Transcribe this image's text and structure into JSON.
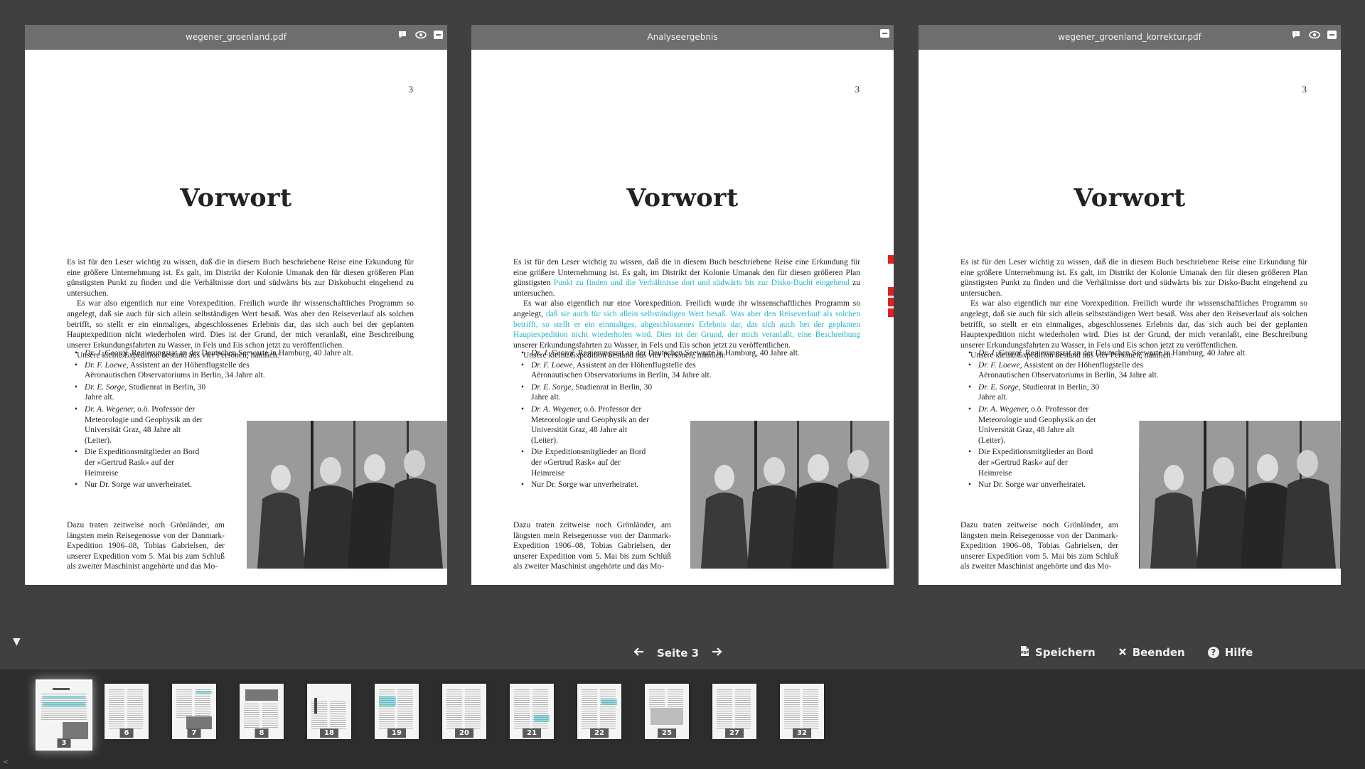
{
  "panels": [
    {
      "title": "wegener_groenland.pdf",
      "has_icons": true
    },
    {
      "title": "Analyseergebnis",
      "has_icons": false
    },
    {
      "title": "wegener_groenland_korrektur.pdf",
      "has_icons": true
    }
  ],
  "icons": {
    "comment": "comment-icon",
    "view": "eye-icon",
    "minimize": "minimize-icon"
  },
  "document": {
    "page_number": "3",
    "heading": "Vorwort",
    "p1": "Es ist für den Leser wichtig zu wissen, daß die in diesem Buch beschriebene Reise eine Erkundung für eine größere Unternehmung ist. Es galt, im Distrikt der Kolonie Umanak den für diesen größeren Plan günstigsten Punkt zu finden und die Verhältnisse dort und südwärts bis zur Diskobucht eingehend zu untersuchen.",
    "p2": "Es war also eigentlich nur eine Vorexpedition. Freilich wurde ihr wissenschaftliches Programm so angelegt, daß sie auch für sich allein selbständigen Wert besaß. Was aber den Reiseverlauf als solchen betrifft, so stellt er ein einmaliges, abgeschlossenes Erlebnis dar, das sich auch bei der geplanten Hauptexpedition nicht wiederholen wird. Dies ist der Grund, der mich veranlaßt, eine Beschreibung unserer Erkundungsfahrten zu Wasser, in Fels und Eis schon jetzt zu veröffentlichen.",
    "p3": "Unsere kleine Expedition bestand aus vier Personen, nämlich:",
    "bullets": [
      {
        "name": "Dr. J. Georgi,",
        "text": " Regierungsrat an der Deutschen Seewarte in Hamburg, 40 Jahre alt."
      },
      {
        "name": "Dr. F. Loewe,",
        "text": " Assistent an der Höhenflugstelle des Aëronautischen Observatoriums in Berlin, 34 Jahre alt."
      },
      {
        "name": "Dr. E. Sorge,",
        "text": " Studienrat in Berlin, 30 Jahre alt."
      },
      {
        "name": "Dr. A. Wegener,",
        "text": " o.ö. Professor der Meteorologie und Geophysik an der Universität Graz, 48 Jahre alt (Leiter)."
      },
      {
        "name": "",
        "text": "Die Expeditionsmitglieder an Bord der »Gertrud Rask« auf der Heimreise"
      },
      {
        "name": "",
        "text": "Nur Dr. Sorge war unverheiratet."
      }
    ],
    "p4": "Dazu traten zeitweise noch Grönländer, am längsten mein Reisegenosse von der Danmark-Expedition 1906–08, Tobias Gabrielsen, der unserer Expedition vom 5. Mai bis zum Schluß als zweiter Maschinist angehörte und das Mo-",
    "p1_korrektur": "Es ist für den Leser wichtig zu wissen, daß die in diesem Buch beschriebene Reise eine Erkundung für eine größere Unternehmung ist. Es galt, im Distrikt der Kolonie Umanak den für diesen größeren Plan günstigsten Punkt zu finden und die Verhältnisse dort und südwärts bis zur Disko-Bucht eingehend zu untersuchen.",
    "p2_korrektur": "Es war also eigentlich nur eine Vorexpedition. Freilich wurde ihr wissenschaftliches Programm so angelegt, daß sie auch für sich allein selbstständigen Wert besaß. Was aber den Reiseverlauf als solchen betrifft, so stellt er ein einmaliges, abgeschlossenes Erlebnis dar, das sich auch bei der geplanten Hauptexpedition nicht wiederholen wird. Dies ist der Grund, der mich veranlaßt, eine Beschreibung unserer Erkundungsfahrten zu Wasser, in Fels und Eis schon jetzt zu veröffentlichen.",
    "p1_analysis_pre": "Es ist für den Leser wichtig zu wissen, daß die in diesem Buch beschriebene Reise eine Erkundung für eine größere Unternehmung ist. Es galt, im Distrikt der Kolonie Umanak den für diesen größeren Plan günstigsten ",
    "p1_analysis_hl": "Punkt zu finden und die Verhältnisse dort und südwärts bis zur Disko-Bucht eingehend",
    "p1_analysis_post": " zu untersuchen.",
    "p2_analysis_pre": "Es war also eigentlich nur eine Vorexpedition. Freilich wurde ihr wissenschaftliches Programm so angelegt, ",
    "p2_analysis_hl": "daß sie auch für sich allein selbständigen Wert besaß. Was aber den Reiseverlauf als solchen betrifft, so stellt er ein einmaliges, abgeschlossenes Erlebnis dar, das sich auch bei der geplanten Hauptexpedition nicht wiederholen wird. Dies ist der Grund, der mich veranlaßt, eine Beschreibung",
    "p2_analysis_post": " unserer Erkundungsfahrten zu Wasser, in Fels und Eis schon jetzt zu veröffentlichen."
  },
  "colors": {
    "highlight": "#1fb8c8",
    "diff_marker": "#e02020",
    "background": "#404040",
    "header": "#6e6e6e"
  },
  "navigation": {
    "prev_icon": "arrow-left-icon",
    "label": "Seite 3",
    "next_icon": "arrow-right-icon"
  },
  "actions": {
    "save": "Speichern",
    "quit": "Beenden",
    "help": "Hilfe"
  },
  "thumbnails": [
    "3",
    "6",
    "7",
    "8",
    "18",
    "19",
    "20",
    "21",
    "22",
    "25",
    "27",
    "32"
  ]
}
